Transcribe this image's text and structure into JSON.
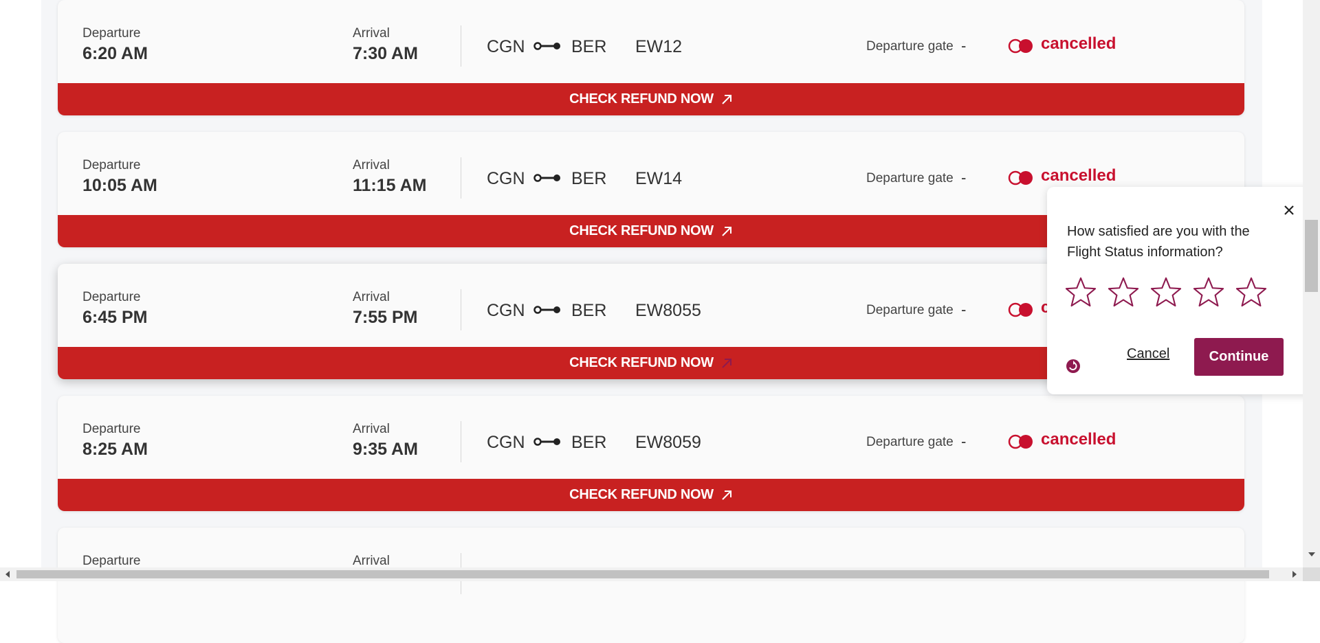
{
  "colors": {
    "accent_red": "#c82121",
    "status_red": "#c8102e",
    "survey_brand": "#8e1a4f"
  },
  "labels": {
    "departure": "Departure",
    "arrival": "Arrival",
    "departure_gate": "Departure gate",
    "refund_button": "CHECK REFUND NOW"
  },
  "flights": [
    {
      "departure_time": "6:20 AM",
      "arrival_time": "7:30 AM",
      "origin": "CGN",
      "destination": "BER",
      "flight_number": "EW12",
      "gate": "-",
      "status": "cancelled"
    },
    {
      "departure_time": "10:05 AM",
      "arrival_time": "11:15 AM",
      "origin": "CGN",
      "destination": "BER",
      "flight_number": "EW14",
      "gate": "-",
      "status": "cancelled"
    },
    {
      "departure_time": "6:45 PM",
      "arrival_time": "7:55 PM",
      "origin": "CGN",
      "destination": "BER",
      "flight_number": "EW8055",
      "gate": "-",
      "status": "cancelled"
    },
    {
      "departure_time": "8:25 AM",
      "arrival_time": "9:35 AM",
      "origin": "CGN",
      "destination": "BER",
      "flight_number": "EW8059",
      "gate": "-",
      "status": "cancelled"
    }
  ],
  "survey": {
    "question": "How satisfied are you with the Flight Status information?",
    "rating_max": 5,
    "rating_selected": 0,
    "cancel_label": "Cancel",
    "continue_label": "Continue",
    "close_icon": "close-icon",
    "logo_icon": "survey-logo-icon"
  },
  "icons": {
    "route": "route-connector-icon",
    "status": "cancelled-status-icon",
    "refund_arrow": "external-arrow-icon",
    "star": "star-outline-icon"
  }
}
